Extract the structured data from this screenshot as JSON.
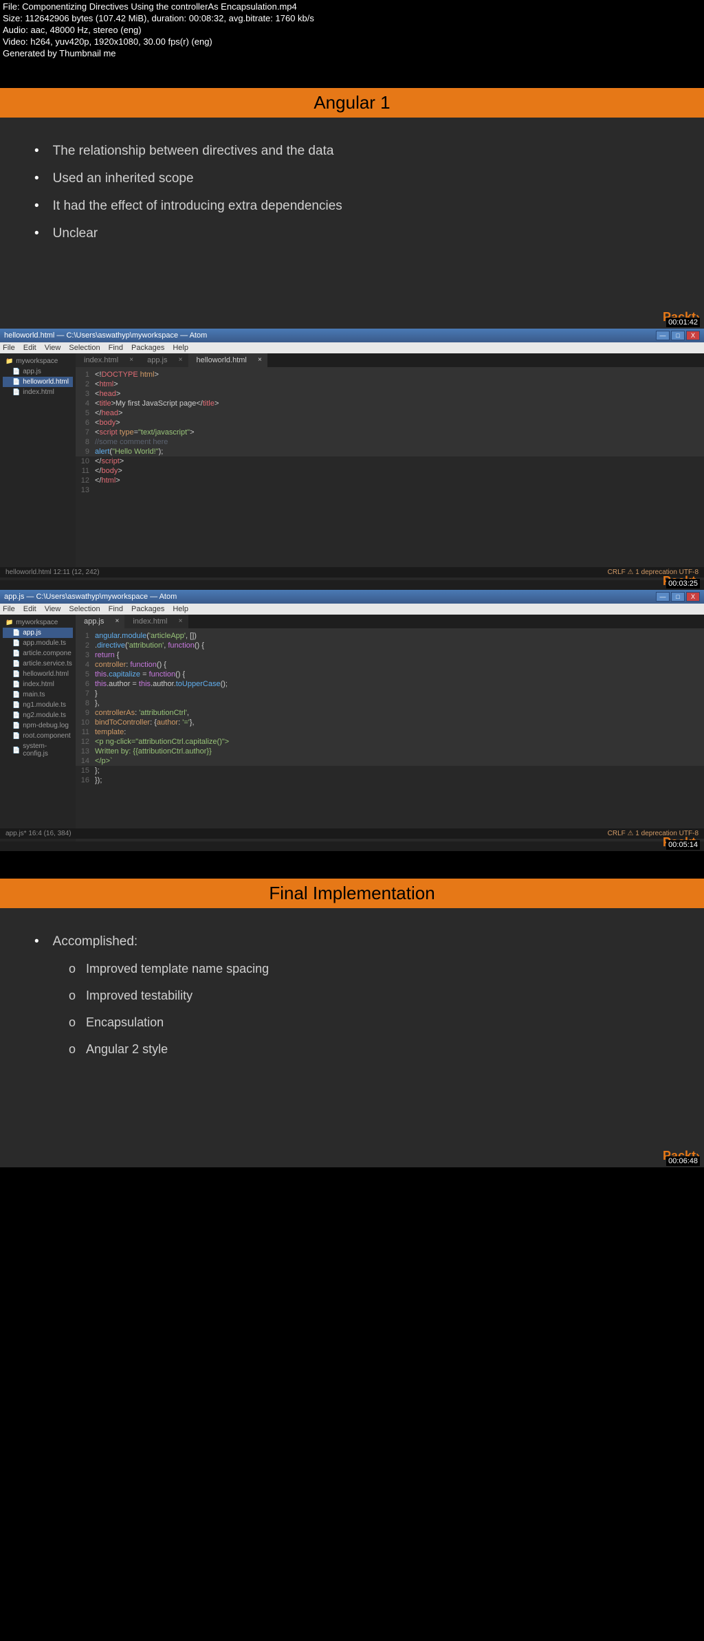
{
  "meta": {
    "l1": "File: Componentizing Directives Using the controllerAs Encapsulation.mp4",
    "l2": "Size: 112642906 bytes (107.42 MiB), duration: 00:08:32, avg.bitrate: 1760 kb/s",
    "l3": "Audio: aac, 48000 Hz, stereo (eng)",
    "l4": "Video: h264, yuv420p, 1920x1080, 30.00 fps(r) (eng)",
    "l5": "Generated by Thumbnail me"
  },
  "slide1": {
    "title": "Angular 1",
    "b1": "The relationship between directives and the data",
    "b2": "Used an inherited scope",
    "b3": "It  had the effect of introducing extra dependencies",
    "b4": "Unclear",
    "ts": "00:01:42",
    "logo": "Packt›"
  },
  "ed1": {
    "wintitle": "helloworld.html — C:\\Users\\aswathyp\\myworkspace — Atom",
    "menu": [
      "File",
      "Edit",
      "View",
      "Selection",
      "Find",
      "Packages",
      "Help"
    ],
    "treeRoot": "myworkspace",
    "tree": [
      "app.js",
      "helloworld.html",
      "index.html"
    ],
    "tabs": [
      "index.html",
      "app.js",
      "helloworld.html"
    ],
    "status_l": "helloworld.html   12:11   (12, 242)",
    "status_r": "CRLF  ⚠ 1 deprecation  UTF-8",
    "ts": "00:03:25",
    "logo": "Packt›"
  },
  "ed2": {
    "wintitle": "app.js — C:\\Users\\aswathyp\\myworkspace — Atom",
    "menu": [
      "File",
      "Edit",
      "View",
      "Selection",
      "Find",
      "Packages",
      "Help"
    ],
    "treeRoot": "myworkspace",
    "tree": [
      "app.js",
      "app.module.ts",
      "article.compone",
      "article.service.ts",
      "helloworld.html",
      "index.html",
      "main.ts",
      "ng1.module.ts",
      "ng2.module.ts",
      "npm-debug.log",
      "root.component",
      "system-config.js"
    ],
    "tabs": [
      "app.js",
      "index.html"
    ],
    "status_l": "app.js*   16:4   (16, 384)",
    "status_r": "CRLF  ⚠ 1 deprecation  UTF-8",
    "ts": "00:05:14",
    "logo": "Packt›"
  },
  "slide2": {
    "title": "Final Implementation",
    "h": "Accomplished:",
    "s1": "Improved template name spacing",
    "s2": "Improved testability",
    "s3": "Encapsulation",
    "s4": "Angular 2 style",
    "ts": "00:06:48",
    "logo": "Packt›"
  }
}
